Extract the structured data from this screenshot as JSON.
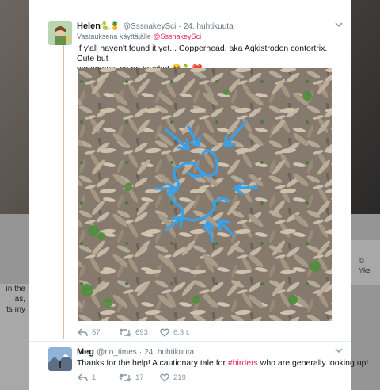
{
  "background": {
    "left_lines": [
      "in the",
      "as,",
      "ts my"
    ],
    "right_lines": [
      "©",
      "Yks"
    ]
  },
  "tweet1": {
    "name": "Helen",
    "handle": "@SssnakeySci",
    "date": "24. huhtikuuta",
    "reply_prefix": "Vastauksena käyttäjälle",
    "reply_handle": "@SssnakeySci",
    "text_line1": "If y'all haven't found it yet... Copperhead, aka Agkistrodon contortrix. Cute but",
    "text_line2": "venomous, so no touchy!",
    "name_emoji": "🐍🍍",
    "text_emoji": "☺️🐍❤️",
    "actions": {
      "replies": "57",
      "retweets": "693",
      "likes": "6,3 t."
    }
  },
  "tweet2": {
    "name": "Meg",
    "handle": "@rio_times",
    "date": "24. huhtikuuta",
    "text_before": "Thanks for the help! A cautionary tale for ",
    "hashtag": "#birders",
    "text_after": " who are generally looking up!",
    "actions": {
      "replies": "1",
      "retweets": "17",
      "likes": "219"
    }
  },
  "colors": {
    "accent": "#e0245e",
    "annotation": "#3aa0e8",
    "icon": "#8899a6"
  },
  "icons": [
    "chevron-down-icon",
    "reply-icon",
    "retweet-icon",
    "heart-icon"
  ]
}
